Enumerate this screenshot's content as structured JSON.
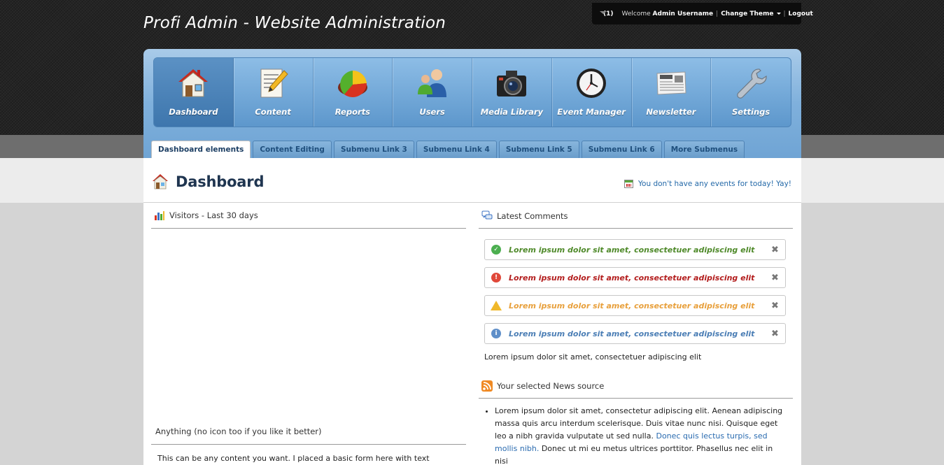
{
  "header": {
    "site_title": "Profi Admin - Website Administration",
    "mail_count": "(1)",
    "welcome": "Welcome",
    "username": "Admin Username",
    "change_theme": "Change Theme",
    "logout": "Logout"
  },
  "nav": {
    "items": [
      {
        "label": "Dashboard",
        "icon": "house-icon"
      },
      {
        "label": "Content",
        "icon": "document-pencil-icon"
      },
      {
        "label": "Reports",
        "icon": "pie-chart-icon"
      },
      {
        "label": "Users",
        "icon": "users-icon"
      },
      {
        "label": "Media Library",
        "icon": "camera-icon"
      },
      {
        "label": "Event Manager",
        "icon": "clock-icon"
      },
      {
        "label": "Newsletter",
        "icon": "newspaper-icon"
      },
      {
        "label": "Settings",
        "icon": "wrench-icon"
      }
    ]
  },
  "subnav": {
    "items": [
      {
        "label": "Dashboard elements"
      },
      {
        "label": "Content Editing"
      },
      {
        "label": "Submenu Link 3"
      },
      {
        "label": "Submenu Link 4"
      },
      {
        "label": "Submenu Link 5"
      },
      {
        "label": "Submenu Link 6"
      },
      {
        "label": "More Submenus"
      }
    ]
  },
  "page": {
    "title": "Dashboard",
    "events_note": "You don't have any events for today! Yay!"
  },
  "visitors": {
    "title": "Visitors - Last 30 days"
  },
  "anything": {
    "title": "Anything (no icon too if you like it better)",
    "text": "This can be any content you want. I placed a basic form here with text"
  },
  "comments": {
    "title": "Latest Comments",
    "items": [
      {
        "text": "Lorem ipsum dolor sit amet, consectetuer adipiscing elit",
        "status": "success"
      },
      {
        "text": "Lorem ipsum dolor sit amet, consectetuer adipiscing elit",
        "status": "error"
      },
      {
        "text": "Lorem ipsum dolor sit amet, consectetuer adipiscing elit",
        "status": "warning"
      },
      {
        "text": "Lorem ipsum dolor sit amet, consectetuer adipiscing elit",
        "status": "info"
      }
    ],
    "footer_text": "Lorem ipsum dolor sit amet, consectetuer adipiscing elit"
  },
  "news": {
    "title": "Your selected News source",
    "item_text_1": "Lorem ipsum dolor sit amet, consectetur adipiscing elit. Aenean adipiscing massa quis arcu interdum scelerisque. Duis vitae nunc nisi. Quisque eget leo a nibh gravida vulputate ut sed nulla.",
    "item_link": "Donec quis lectus turpis, sed mollis nibh.",
    "item_text_2": "Donec ut mi eu metus ultrices porttitor. Phasellus nec elit in nisi"
  },
  "colors": {
    "nav_blue": "#6fa4d4",
    "title_navy": "#1f3550",
    "success": "#4f8a2a",
    "error": "#b31d1d",
    "warning": "#e8a03c",
    "info": "#4b7eb5"
  }
}
